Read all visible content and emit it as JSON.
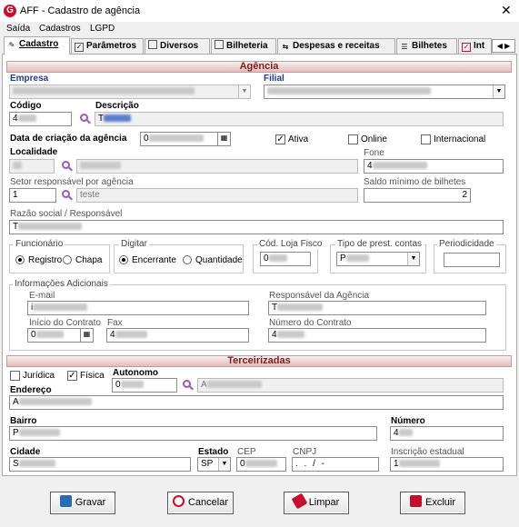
{
  "window": {
    "app_abbrev": "G",
    "title": "AFF - Cadastro de agência",
    "close_glyph": "✕"
  },
  "menu": [
    "Saída",
    "Cadastros",
    "LGPD"
  ],
  "tabs": [
    {
      "label": "Cadastro",
      "active": true,
      "icon": "pencil-icon"
    },
    {
      "label": "Parâmetros",
      "icon": "checkbox-icon"
    },
    {
      "label": "Diversos",
      "icon": "document-icon"
    },
    {
      "label": "Bilheteria",
      "icon": "document-icon"
    },
    {
      "label": "Despesas e receitas",
      "icon": "transfer-icon"
    },
    {
      "label": "Bilhetes",
      "icon": "list-icon"
    },
    {
      "label": "Int",
      "icon": "checkbox-red-icon"
    }
  ],
  "tab_arrows": "◀ ▶",
  "agencia": {
    "section_title": "Agência",
    "empresa_label": "Empresa",
    "filial_label": "Filial",
    "codigo_label": "Código",
    "descricao_label": "Descrição",
    "codigo_value": "4",
    "descricao_value": "T",
    "data_criacao_label": "Data de criação da agência",
    "data_criacao_value": "0",
    "ativa_label": "Ativa",
    "ativa_checked": true,
    "online_label": "Online",
    "internacional_label": "Internacional",
    "localidade_label": "Localidade",
    "fone_label": "Fone",
    "fone_value": "4",
    "setor_label": "Setor responsável por agência",
    "setor_code": "1",
    "setor_desc": "teste",
    "saldo_label": "Saldo mínimo de bilhetes",
    "saldo_value": "2",
    "razao_label": "Razão social / Responsável",
    "razao_value": "T",
    "funcionario_group": "Funcionário",
    "funcionario_options": [
      "Registro",
      "Chapa"
    ],
    "digitar_group": "Digitar",
    "digitar_options": [
      "Encerrante",
      "Quantidade"
    ],
    "cod_loja_label": "Cód. Loja Fisco",
    "cod_loja_value": "0",
    "tipo_prest_label": "Tipo de prest. contas",
    "tipo_prest_value": "P",
    "periodicidade_label": "Periodicidade",
    "info_group": "Informações Adicionais",
    "email_label": "E-mail",
    "email_value": "i",
    "responsavel_label": "Responsável da Agência",
    "responsavel_value": "T",
    "inicio_contrato_label": "Início do Contrato",
    "inicio_contrato_value": "0",
    "fax_label": "Fax",
    "fax_value": "4",
    "numero_contrato_label": "Número do Contrato",
    "numero_contrato_value": "4"
  },
  "terceirizadas": {
    "section_title": "Terceirizadas",
    "juridica_label": "Jurídica",
    "fisica_label": "Física",
    "fisica_checked": true,
    "autonomo_label": "Autonomo",
    "autonomo_code": "0",
    "autonomo_name": "A",
    "endereco_label": "Endereço",
    "endereco_value": "A",
    "bairro_label": "Bairro",
    "bairro_value": "P",
    "numero_label": "Número",
    "numero_value": "4",
    "cidade_label": "Cidade",
    "cidade_value": "S",
    "estado_label": "Estado",
    "estado_value": "SP",
    "cep_label": "CEP",
    "cep_value": "0",
    "cnpj_label": "CNPJ",
    "cnpj_value": ". . / -",
    "inscricao_label": "Inscrição estadual",
    "inscricao_value": "1"
  },
  "buttons": {
    "gravar": "Gravar",
    "cancelar": "Cancelar",
    "limpar": "Limpar",
    "excluir": "Excluir"
  },
  "colors": {
    "section_text": "#7a1f1f",
    "label_blue": "#1f3d8a",
    "search_icon": "#9b59b6",
    "app_icon": "#c8102e"
  }
}
